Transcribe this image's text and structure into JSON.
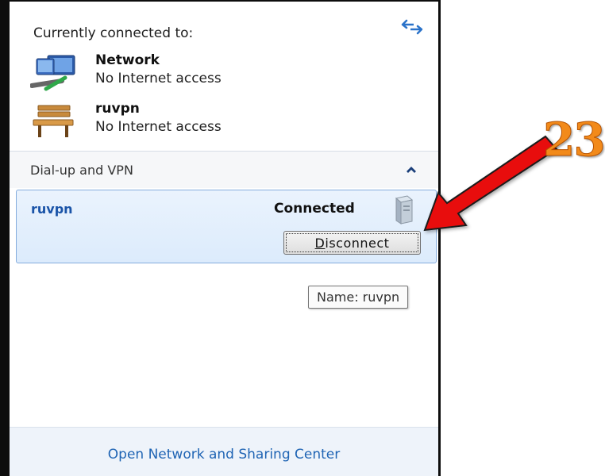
{
  "panel": {
    "header": "Currently connected to:",
    "connections": [
      {
        "name": "Network",
        "status": "No Internet access",
        "icon": "network-icon"
      },
      {
        "name": "ruvpn",
        "status": "No Internet access",
        "icon": "bench-icon"
      }
    ],
    "section": {
      "title": "Dial-up and VPN"
    },
    "vpn": {
      "name": "ruvpn",
      "status": "Connected",
      "button_label": "Disconnect",
      "button_accesskey": "D"
    },
    "tooltip": "Name: ruvpn",
    "footer_link": "Open Network and Sharing Center"
  },
  "annotation": {
    "step": "23",
    "colors": {
      "arrow": "#e81010",
      "step_text": "#f28a1a"
    }
  },
  "colors": {
    "link": "#1f64b4",
    "vpn_name": "#1a54a8",
    "selection_border": "#84acdd"
  }
}
